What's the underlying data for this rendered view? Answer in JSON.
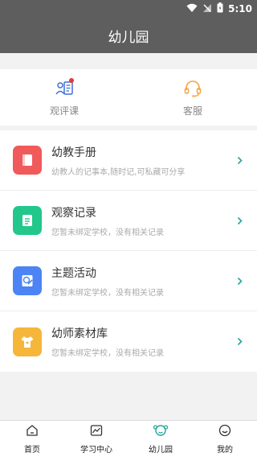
{
  "status": {
    "time": "5:10"
  },
  "header": {
    "title": "幼儿园"
  },
  "quick": [
    {
      "label": "观评课",
      "icon": "classroom-review-icon",
      "has_dot": true
    },
    {
      "label": "客服",
      "icon": "headset-icon"
    }
  ],
  "list": [
    {
      "title": "幼教手册",
      "subtitle": "幼教人的记事本,随时记,可私藏可分享",
      "icon": "book-icon",
      "color": "#f05a5a"
    },
    {
      "title": "观察记录",
      "subtitle": "您暂未绑定学校，没有相关记录",
      "icon": "document-icon",
      "color": "#22c78b"
    },
    {
      "title": "主题活动",
      "subtitle": "您暂未绑定学校，没有相关记录",
      "icon": "palette-icon",
      "color": "#4c84f5"
    },
    {
      "title": "幼师素材库",
      "subtitle": "您暂未绑定学校，没有相关记录",
      "icon": "tshirt-icon",
      "color": "#f6b63a"
    }
  ],
  "tabbar": [
    {
      "label": "首页",
      "icon": "home-icon"
    },
    {
      "label": "学习中心",
      "icon": "chart-icon"
    },
    {
      "label": "幼儿园",
      "icon": "kindergarten-icon",
      "active": true
    },
    {
      "label": "我的",
      "icon": "smiley-icon"
    }
  ],
  "colors": {
    "header_bg": "#5e5e5e",
    "accent_teal": "#27a59b",
    "icon_blue": "#3e6fd6",
    "icon_orange": "#f4a340"
  }
}
